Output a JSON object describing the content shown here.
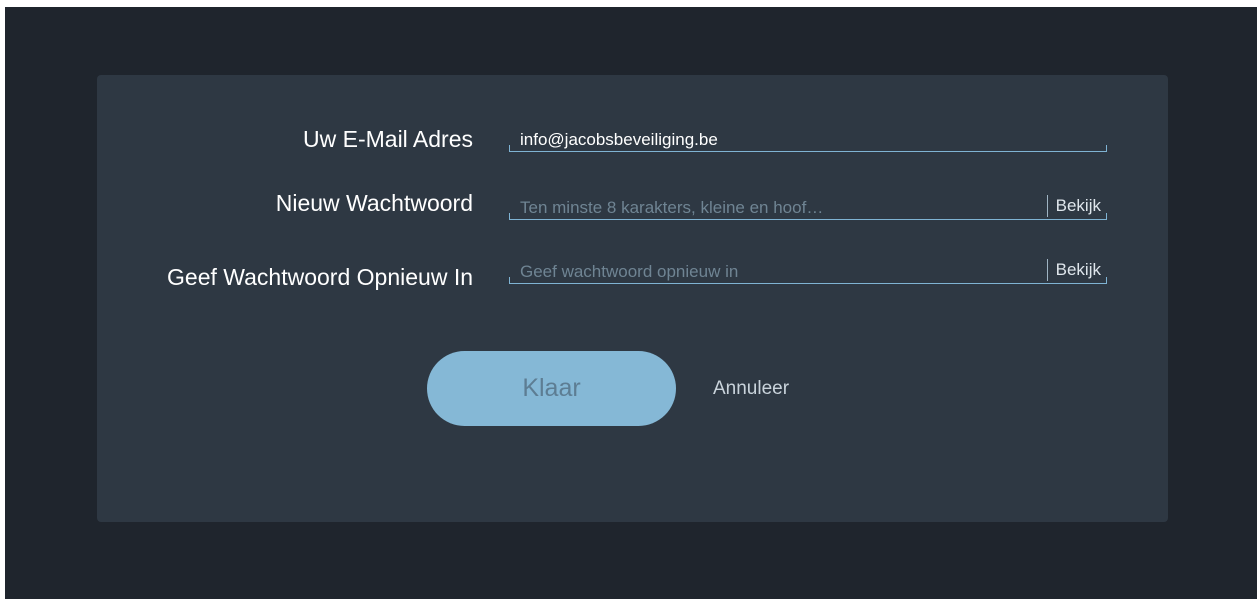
{
  "form": {
    "email_label": "Uw E-Mail Adres",
    "email_value": "info@jacobsbeveiliging.be",
    "new_password_label": "Nieuw Wachtwoord",
    "new_password_placeholder": "Ten minste 8 karakters, kleine en hoof…",
    "confirm_password_label": "Geef Wachtwoord Opnieuw In",
    "confirm_password_placeholder": "Geef wachtwoord opnieuw in",
    "show_label": "Bekijk",
    "done_label": "Klaar",
    "cancel_label": "Annuleer"
  }
}
